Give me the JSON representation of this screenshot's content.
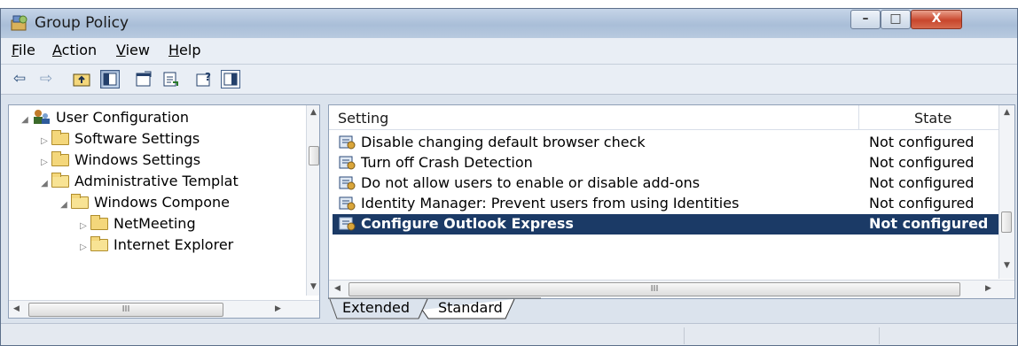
{
  "window": {
    "title": "Group Policy",
    "controls": {
      "minimize": "–",
      "maximize": "□",
      "close": "X"
    }
  },
  "menu": {
    "items": [
      "File",
      "Action",
      "View",
      "Help"
    ],
    "mnemonics": [
      "F",
      "A",
      "V",
      "H"
    ]
  },
  "toolbar": {
    "buttons": [
      "back-arrow-icon",
      "forward-arrow-icon",
      "up-folder-icon",
      "show-hide-tree-icon",
      "properties-icon",
      "export-list-icon",
      "help-icon",
      "console-tree-icon"
    ]
  },
  "tree": {
    "items": [
      {
        "label": "User Configuration",
        "expanded": true
      },
      {
        "label": "Software Settings",
        "expanded": false
      },
      {
        "label": "Windows Settings",
        "expanded": false
      },
      {
        "label": "Administrative Templat",
        "expanded": true
      },
      {
        "label": "Windows Compone",
        "expanded": true
      },
      {
        "label": "NetMeeting",
        "expanded": false
      },
      {
        "label": "Internet Explorer",
        "expanded": false
      }
    ],
    "hscroll_thumb": "III"
  },
  "list": {
    "columns": {
      "setting": "Setting",
      "state": "State"
    },
    "rows": [
      {
        "setting": "Disable changing default browser check",
        "state": "Not configured",
        "selected": false
      },
      {
        "setting": "Turn off Crash Detection",
        "state": "Not configured",
        "selected": false
      },
      {
        "setting": "Do not allow users to enable or disable add-ons",
        "state": "Not configured",
        "selected": false
      },
      {
        "setting": "Identity Manager: Prevent users from using Identities",
        "state": "Not configured",
        "selected": false
      },
      {
        "setting": "Configure Outlook Express",
        "state": "Not configured",
        "selected": true
      }
    ],
    "hscroll_thumb": "III"
  },
  "tabs": {
    "extended": "Extended",
    "standard": "Standard",
    "active": "Standard"
  },
  "colors": {
    "selection": "#1b3a66",
    "titlebar": "#b8cadf",
    "close": "#c8462c"
  }
}
